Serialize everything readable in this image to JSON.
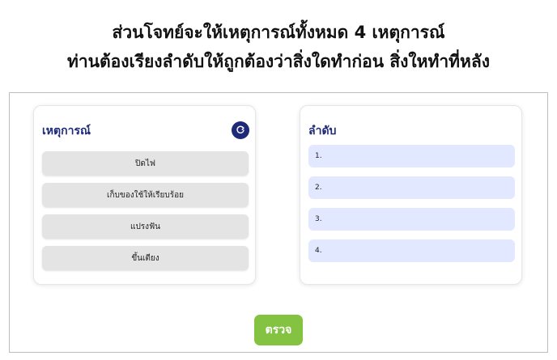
{
  "heading": {
    "line1": "ส่วนโจทย์จะให้เหตุการณ์ทั้งหมด 4 เหตุการณ์",
    "line2": "ท่านต้องเรียงลำดับให้ถูกต้องว่าสิ่งใดทำก่อน สิ่งใหทำที่หลัง"
  },
  "events_panel": {
    "title": "เหตุการณ์",
    "items": [
      "ปิดไฟ",
      "เก็บของใช้ให้เรียบร้อย",
      "แปรงฟัน",
      "ขึ้นเตียง"
    ]
  },
  "order_panel": {
    "title": "ลำดับ",
    "slots": [
      "1.",
      "2.",
      "3.",
      "4."
    ]
  },
  "check_button": {
    "label": "ตรวจ"
  },
  "colors": {
    "title": "#1e2a78",
    "event_bg": "#e4e4e4",
    "slot_bg": "#e1e8ff",
    "check_button": "#84c341"
  },
  "icons": {
    "reset": "refresh-icon"
  }
}
